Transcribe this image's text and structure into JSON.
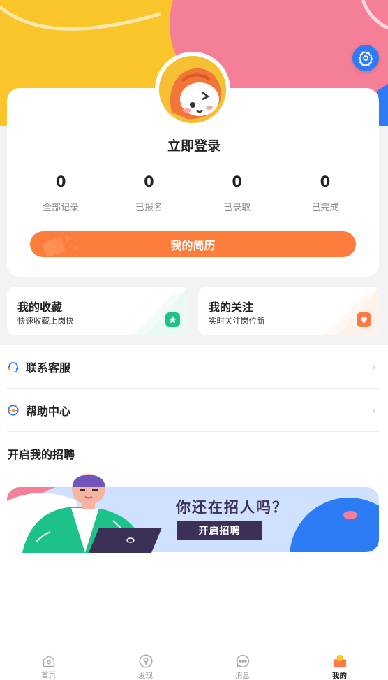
{
  "colors": {
    "accent_orange": "#fd7d3c",
    "hero_yellow": "#f9c52a",
    "hero_pink": "#f57f96",
    "settings_blue": "#2d7cf6",
    "banner_navy": "#3c3057"
  },
  "header": {
    "settings_icon": "gear-icon"
  },
  "profile": {
    "login_text": "立即登录",
    "stats": [
      {
        "value": "0",
        "label": "全部记录"
      },
      {
        "value": "0",
        "label": "已报名"
      },
      {
        "value": "0",
        "label": "已录取"
      },
      {
        "value": "0",
        "label": "已完成"
      }
    ],
    "resume_button": "我的简历"
  },
  "quick_cards": [
    {
      "title": "我的收藏",
      "subtitle": "快速收藏上岗快",
      "icon": "star-icon",
      "badge_color": "#1cc28a"
    },
    {
      "title": "我的关注",
      "subtitle": "实时关注岗位新",
      "icon": "heart-icon",
      "badge_color": "#ff7b45"
    }
  ],
  "menu": [
    {
      "label": "联系客服",
      "icon": "headset-icon"
    },
    {
      "label": "帮助中心",
      "icon": "help-icon"
    }
  ],
  "recruit": {
    "section_title": "开启我的招聘",
    "banner_headline": "你还在招人吗？",
    "banner_button": "开启招聘"
  },
  "tabbar": [
    {
      "label": "首页",
      "icon": "home-icon",
      "active": false
    },
    {
      "label": "发现",
      "icon": "discover-icon",
      "active": false
    },
    {
      "label": "消息",
      "icon": "message-icon",
      "active": false
    },
    {
      "label": "我的",
      "icon": "profile-icon",
      "active": true
    }
  ]
}
